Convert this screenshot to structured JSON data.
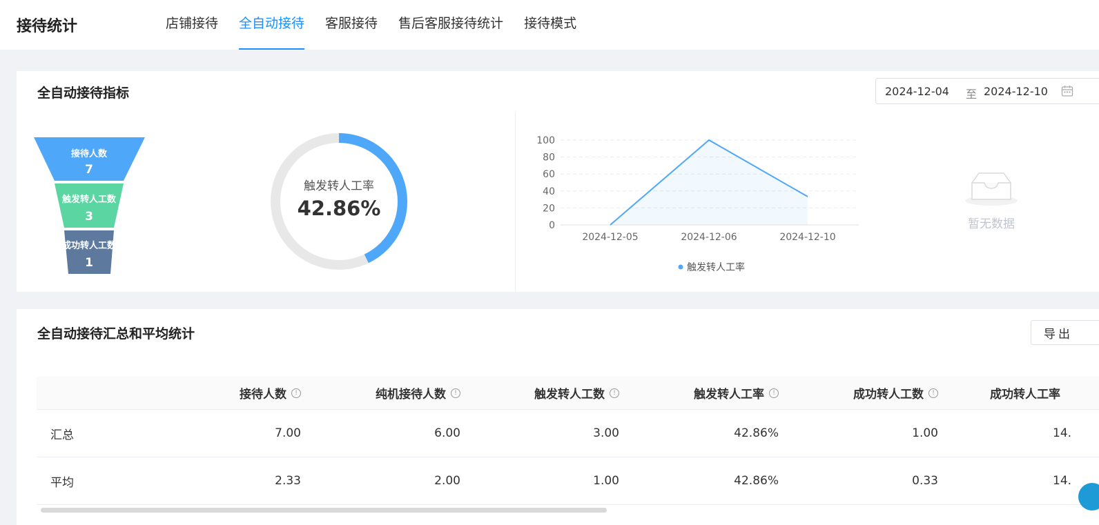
{
  "header": {
    "title": "接待统计",
    "tabs": [
      {
        "label": "店铺接待",
        "active": false
      },
      {
        "label": "全自动接待",
        "active": true
      },
      {
        "label": "客服接待",
        "active": false
      },
      {
        "label": "售后客服接待统计",
        "active": false
      },
      {
        "label": "接待模式",
        "active": false
      }
    ]
  },
  "metrics": {
    "title": "全自动接待指标",
    "date_range": {
      "start": "2024-12-04",
      "separator": "至",
      "end": "2024-12-10"
    },
    "funnel": [
      {
        "label": "接待人数",
        "value": "7",
        "color": "#4ea7f8"
      },
      {
        "label": "触发转人工数",
        "value": "3",
        "color": "#5bd6a3"
      },
      {
        "label": "成功转人工数",
        "value": "1",
        "color": "#5d7a9e"
      }
    ],
    "donut": {
      "label": "触发转人工率",
      "value_text": "42.86%",
      "fraction": 0.4286,
      "color": "#4ea7f8",
      "track_color": "#e8e8e8"
    },
    "empty_text": "暂无数据"
  },
  "chart_data": {
    "type": "area",
    "categories": [
      "2024-12-05",
      "2024-12-06",
      "2024-12-10"
    ],
    "series": [
      {
        "name": "触发转人工率",
        "values": [
          0,
          100,
          33.33
        ]
      }
    ],
    "ylim": [
      0,
      100
    ],
    "yticks": [
      0,
      20,
      40,
      60,
      80,
      100
    ],
    "grid": true,
    "legend": "bottom",
    "color": "#4ea7f8"
  },
  "summary": {
    "title": "全自动接待汇总和平均统计",
    "export_label": "导出",
    "columns": [
      "",
      "接待人数",
      "纯机接待人数",
      "触发转人工数",
      "触发转人工率",
      "成功转人工数",
      "成功转人工率"
    ],
    "rows": [
      [
        "汇总",
        "7.00",
        "6.00",
        "3.00",
        "42.86%",
        "1.00",
        "14."
      ],
      [
        "平均",
        "2.33",
        "2.00",
        "1.00",
        "42.86%",
        "0.33",
        "14."
      ]
    ]
  }
}
